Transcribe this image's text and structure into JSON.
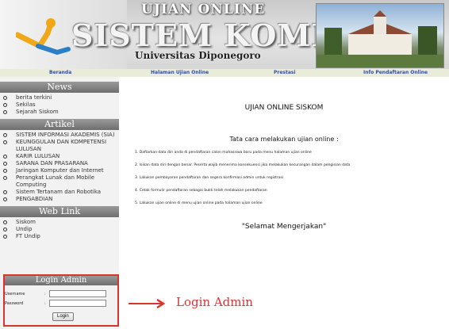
{
  "banner": {
    "title_top": "UJIAN ONLINE",
    "title_main": "SISTEM KOMPUTER",
    "subtitle": "Universitas Diponegoro"
  },
  "nav": [
    {
      "label": "Beranda"
    },
    {
      "label": "Halaman Ujian Online"
    },
    {
      "label": "Prestasi"
    },
    {
      "label": "Info Pendaftaran Online"
    }
  ],
  "sidebar": {
    "news": {
      "title": "News",
      "items": [
        "berita terkini",
        "Sekilas",
        "Sejarah Siskom"
      ]
    },
    "artikel": {
      "title": "Artikel",
      "items": [
        "SISTEM INFORMASI AKADEMIS (SIA)",
        "KEUNGGULAN DAN KOMPETENSI LULUSAN",
        "KARIR LULUSAN",
        "SARANA DAN PRASARANA",
        "Jaringan Komputer dan Internet",
        "Perangkat Lunak dan Mobile Computing",
        "Sistem Tertanam dan Robotika",
        "PENGABDIAN"
      ]
    },
    "weblink": {
      "title": "Web Link",
      "items": [
        "Siskom",
        "Undip",
        "FT Undip"
      ]
    }
  },
  "login": {
    "title": "Login Admin",
    "username_label": "Username",
    "password_label": "Password",
    "colon": ":",
    "button": "Login"
  },
  "main": {
    "heading": "UJIAN ONLINE SISKOM",
    "subheading": "Tata cara melakukan ujian online :",
    "steps": [
      "1. Daftarkan data diri anda di pendaftaran calon mahasiswa baru pada menu halaman ujian online",
      "2. Isikan data diri dengan benar. Peserta wajib menerima konsekuensi jika melakukan kecurangan dalam pengisian data",
      "3. Lakukan pembayaran pendaftaran dan segera konfirmasi admin untuk registrasi",
      "4. Cetak formulir pendaftaran sebagai bukti telah melakukan pendaftaran",
      "5. Lakukan ujian online di menu ujian online pada halaman ujian online"
    ],
    "closing": "\"Selamat Mengerjakan\""
  },
  "annotation": {
    "label": "Login Admin",
    "color": "#d9352d"
  },
  "colors": {
    "nav_text": "#2f4fa8",
    "section_header": "#7a7a7a",
    "sidebar_bg": "#f2f2f2"
  }
}
